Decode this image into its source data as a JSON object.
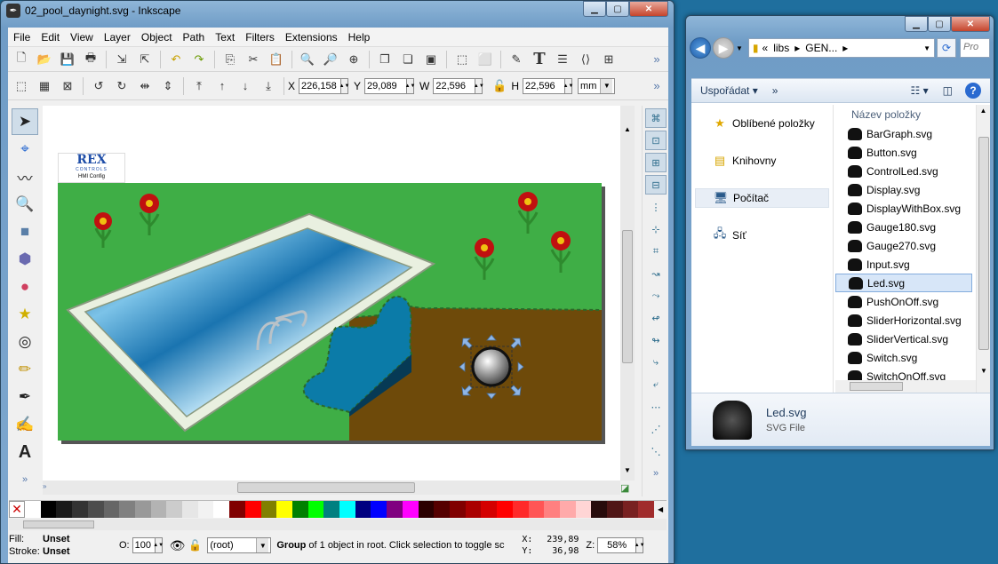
{
  "inkscape": {
    "title": "02_pool_daynight.svg - Inkscape",
    "menu": [
      "File",
      "Edit",
      "View",
      "Layer",
      "Object",
      "Path",
      "Text",
      "Filters",
      "Extensions",
      "Help"
    ],
    "coords": {
      "x_label": "X",
      "x": "226,158",
      "y_label": "Y",
      "y": "29,089",
      "w_label": "W",
      "w": "22,596",
      "h_label": "H",
      "h": "22,596",
      "unit": "mm"
    },
    "logo": {
      "brand": "REX",
      "sub": "CONTROLS",
      "caption": "HMI Config"
    },
    "palette": [
      "#ffffff",
      "#000000",
      "#1a1a1a",
      "#333333",
      "#4d4d4d",
      "#666666",
      "#808080",
      "#999999",
      "#b3b3b3",
      "#cccccc",
      "#e6e6e6",
      "#f2f2f2",
      "#ffffff",
      "#800000",
      "#ff0000",
      "#808000",
      "#ffff00",
      "#008000",
      "#00ff00",
      "#008080",
      "#00ffff",
      "#000080",
      "#0000ff",
      "#800080",
      "#ff00ff",
      "#2b0000",
      "#550000",
      "#800000",
      "#aa0000",
      "#d40000",
      "#ff0000",
      "#ff2a2a",
      "#ff5555",
      "#ff8080",
      "#ffaaaa",
      "#ffd5d5",
      "#280b0b",
      "#501616",
      "#782121",
      "#a02c2c"
    ],
    "status": {
      "fill_label": "Fill:",
      "fill_value": "Unset",
      "stroke_label": "Stroke:",
      "stroke_value": "Unset",
      "opacity_label": "O:",
      "opacity": "100",
      "layer": "(root)",
      "message_bold": "Group",
      "message": " of 1 object in root. Click selection to toggle sc",
      "x_label": "X:",
      "x": "239,89",
      "y_label": "Y:",
      "y": "36,98",
      "zoom_label": "Z:",
      "zoom": "58%"
    }
  },
  "explorer": {
    "path": [
      "«",
      "libs",
      "▸",
      "GEN...",
      "▸"
    ],
    "search_placeholder": "Pro",
    "organize": "Uspořádat",
    "more": "»",
    "nav": [
      "Oblíbené položky",
      "Knihovny",
      "Počítač",
      "Síť"
    ],
    "column_header": "Název položky",
    "files": [
      "BarGraph.svg",
      "Button.svg",
      "ControlLed.svg",
      "Display.svg",
      "DisplayWithBox.svg",
      "Gauge180.svg",
      "Gauge270.svg",
      "Input.svg",
      "Led.svg",
      "PushOnOff.svg",
      "SliderHorizontal.svg",
      "SliderVertical.svg",
      "Switch.svg",
      "SwitchOnOff.svg"
    ],
    "selected_file": "Led.svg",
    "details_name": "Led.svg",
    "details_type": "SVG File"
  }
}
